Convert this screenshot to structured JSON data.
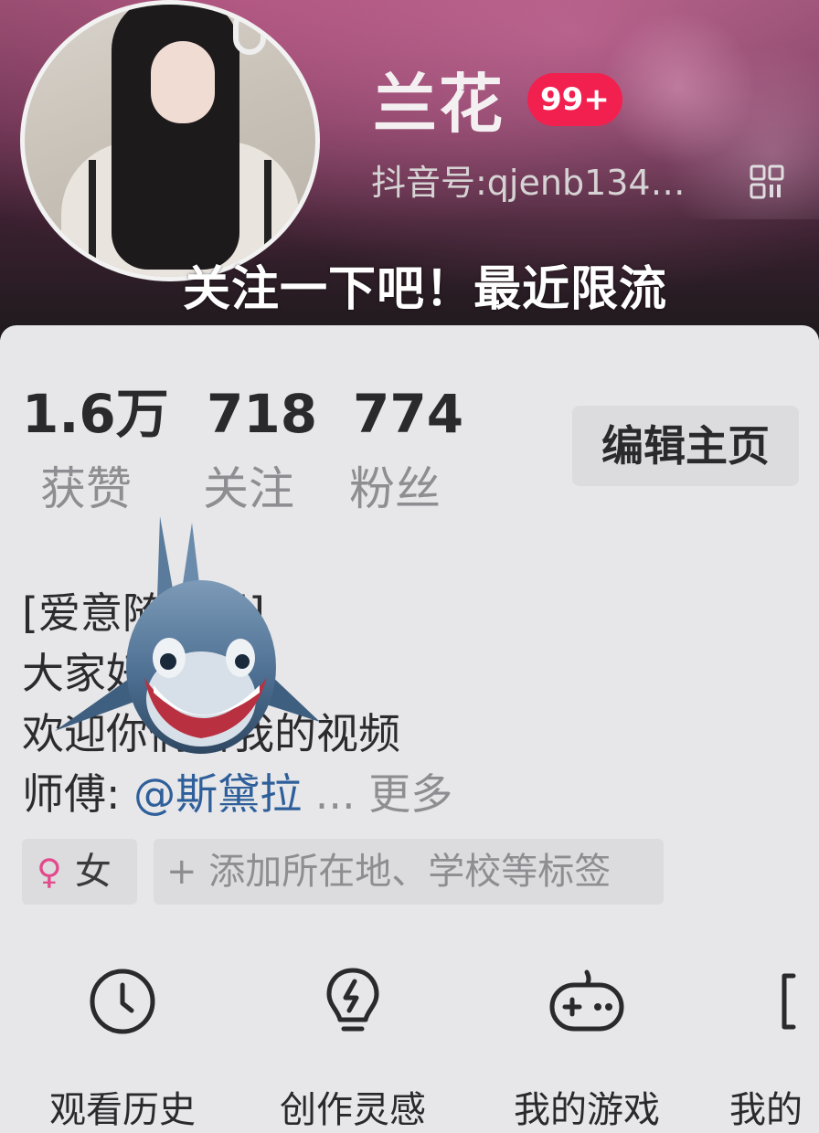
{
  "header": {
    "name": "兰花",
    "notification_badge": "99+",
    "account_id": "抖音号:qjenb134…",
    "overlay_caption": "关注一下吧！最近限流"
  },
  "stats": [
    {
      "value": "1.6万",
      "label": "获赞"
    },
    {
      "value": "718",
      "label": "关注"
    },
    {
      "value": "774",
      "label": "粉丝"
    }
  ],
  "edit_profile_label": "编辑主页",
  "bio": {
    "line1": "[爱意随风起]",
    "line2": "大家好",
    "line3": "欢迎你们看我的视频",
    "line4_prefix": "师傅: ",
    "mention": "@斯黛拉",
    "ellipsis": " ... ",
    "more": "更多"
  },
  "tags": {
    "gender_symbol": "♀",
    "gender": "女",
    "add_tag": "+ 添加所在地、学校等标签"
  },
  "tools": [
    {
      "icon": "clock-icon",
      "label": "观看历史"
    },
    {
      "icon": "lightbulb-icon",
      "label": "创作灵感"
    },
    {
      "icon": "gamepad-icon",
      "label": "我的游戏"
    },
    {
      "icon": "bracket-icon",
      "label": "我的"
    }
  ],
  "colors": {
    "badge": "#f2204e",
    "mention": "#2e5f9a",
    "female": "#e24a8c"
  }
}
